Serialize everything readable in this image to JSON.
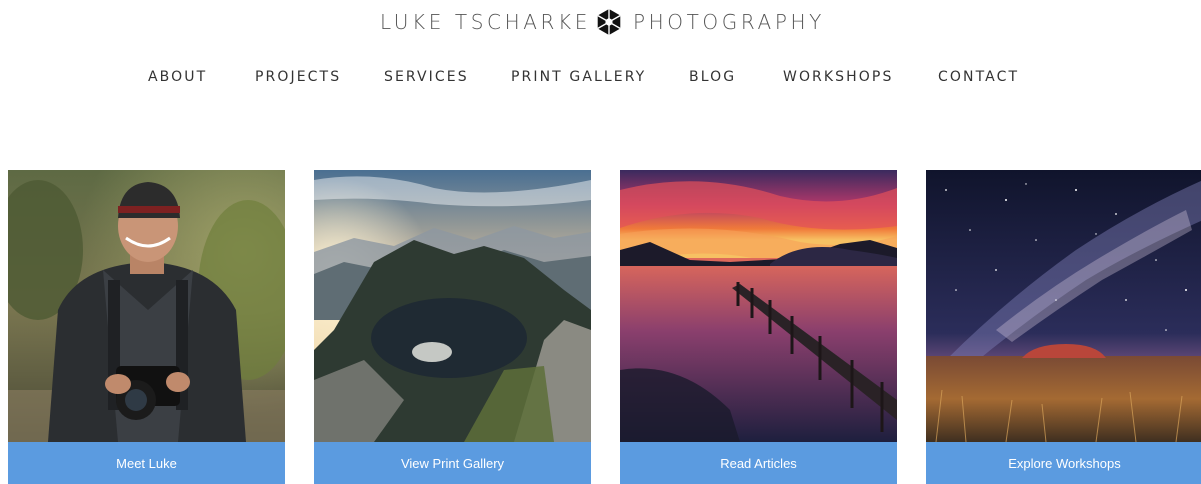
{
  "brand": {
    "name_left": "LUKE TSCHARKE",
    "name_right": "PHOTOGRAPHY",
    "logo_icon": "aperture-logo-icon"
  },
  "nav": {
    "items": [
      {
        "label": "ABOUT"
      },
      {
        "label": "PROJECTS"
      },
      {
        "label": "SERVICES"
      },
      {
        "label": "PRINT GALLERY"
      },
      {
        "label": "BLOG"
      },
      {
        "label": "WORKSHOPS"
      },
      {
        "label": "CONTACT"
      }
    ]
  },
  "cards": [
    {
      "button_label": "Meet Luke",
      "image": "photographer-portrait"
    },
    {
      "button_label": "View Print Gallery",
      "image": "mountain-lake-landscape"
    },
    {
      "button_label": "Read Articles",
      "image": "sunset-jetty-lake"
    },
    {
      "button_label": "Explore Workshops",
      "image": "milky-way-uluru"
    }
  ],
  "colors": {
    "button_bg": "#5b9be0",
    "button_text": "#ffffff",
    "nav_text": "#333333",
    "logo_text": "#555555"
  }
}
